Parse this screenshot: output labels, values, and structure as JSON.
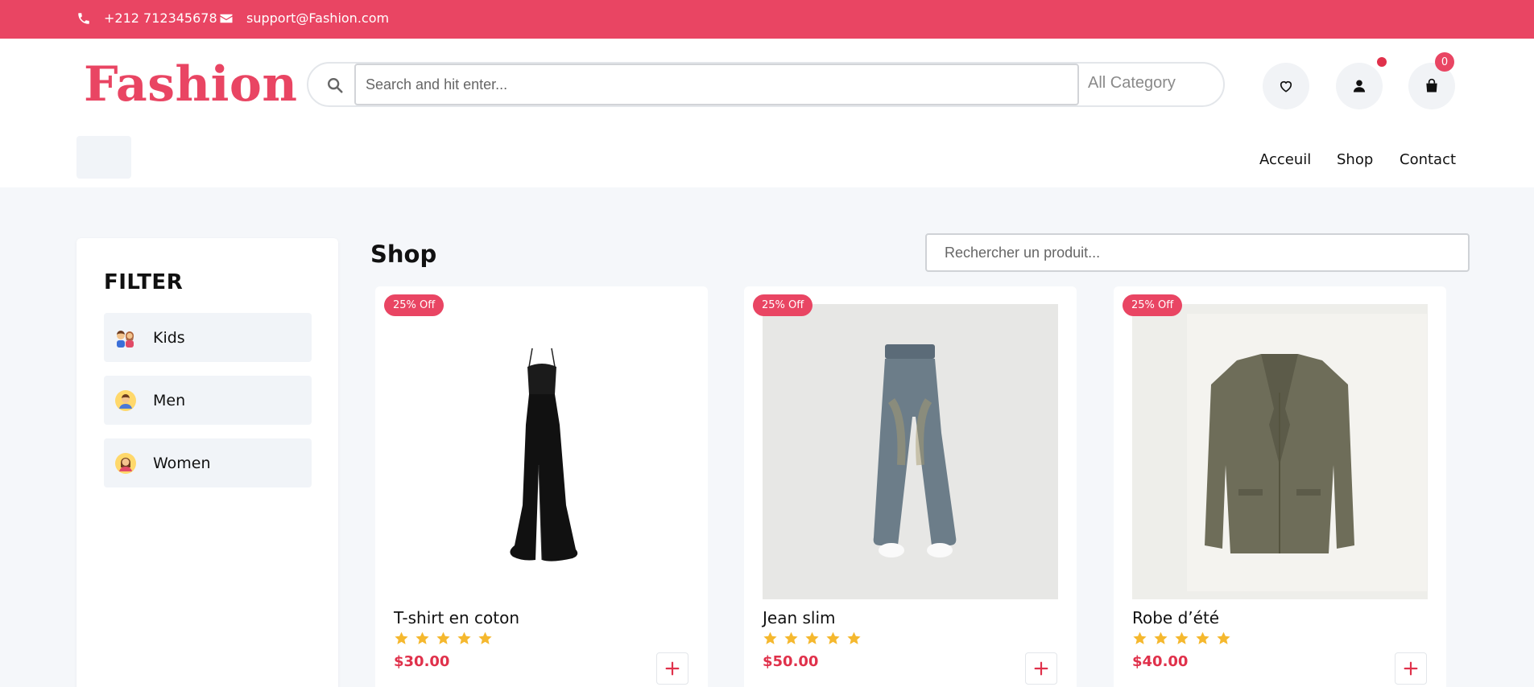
{
  "topbar": {
    "phone": "+212 712345678",
    "email": "support@Fashion.com",
    "phone_icon": "phone-icon",
    "email_icon": "envelope-icon"
  },
  "header": {
    "logo": "Fashion",
    "search_placeholder": "Search and hit enter...",
    "category": "All Category",
    "cart_count": "0"
  },
  "nav": {
    "home": "Acceuil",
    "shop": "Shop",
    "contact": "Contact"
  },
  "sidebar": {
    "title": "FILTER",
    "items": [
      {
        "label": "Kids",
        "icon": "kids-icon"
      },
      {
        "label": "Men",
        "icon": "man-icon"
      },
      {
        "label": "Women",
        "icon": "woman-icon"
      }
    ]
  },
  "shop": {
    "title": "Shop",
    "search_placeholder": "Rechercher un produit..."
  },
  "products": [
    {
      "badge": "25% Off",
      "name": "T-shirt en coton",
      "price": "$30.00",
      "rating": 5,
      "image": "black-dress"
    },
    {
      "badge": "25% Off",
      "name": "Jean slim",
      "price": "$50.00",
      "rating": 5,
      "image": "wide-jeans"
    },
    {
      "badge": "25% Off",
      "name": "Robe d’été",
      "price": "$40.00",
      "rating": 5,
      "image": "olive-blazer"
    }
  ],
  "colors": {
    "brand": "#e94563",
    "star": "#f5b82e",
    "price": "#e0314b"
  }
}
